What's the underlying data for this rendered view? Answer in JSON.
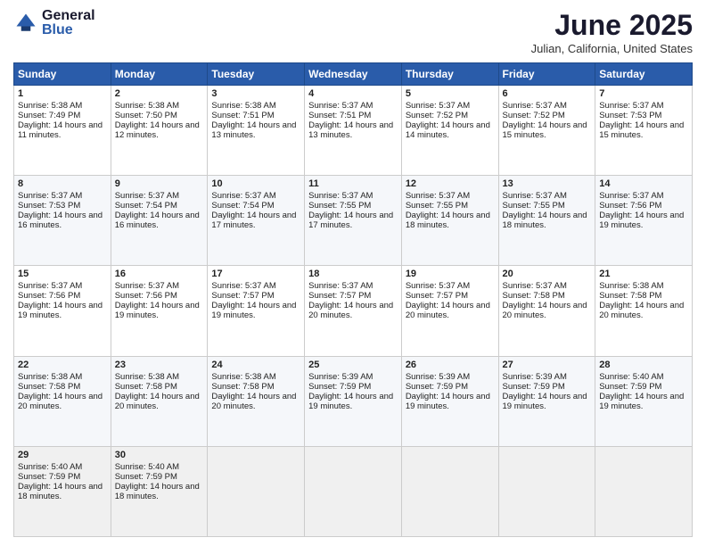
{
  "header": {
    "logo_general": "General",
    "logo_blue": "Blue",
    "month_title": "June 2025",
    "location": "Julian, California, United States"
  },
  "weekdays": [
    "Sunday",
    "Monday",
    "Tuesday",
    "Wednesday",
    "Thursday",
    "Friday",
    "Saturday"
  ],
  "weeks": [
    [
      {
        "day": "1",
        "sunrise": "5:38 AM",
        "sunset": "7:49 PM",
        "daylight": "14 hours and 11 minutes."
      },
      {
        "day": "2",
        "sunrise": "5:38 AM",
        "sunset": "7:50 PM",
        "daylight": "14 hours and 12 minutes."
      },
      {
        "day": "3",
        "sunrise": "5:38 AM",
        "sunset": "7:51 PM",
        "daylight": "14 hours and 13 minutes."
      },
      {
        "day": "4",
        "sunrise": "5:37 AM",
        "sunset": "7:51 PM",
        "daylight": "14 hours and 13 minutes."
      },
      {
        "day": "5",
        "sunrise": "5:37 AM",
        "sunset": "7:52 PM",
        "daylight": "14 hours and 14 minutes."
      },
      {
        "day": "6",
        "sunrise": "5:37 AM",
        "sunset": "7:52 PM",
        "daylight": "14 hours and 15 minutes."
      },
      {
        "day": "7",
        "sunrise": "5:37 AM",
        "sunset": "7:53 PM",
        "daylight": "14 hours and 15 minutes."
      }
    ],
    [
      {
        "day": "8",
        "sunrise": "5:37 AM",
        "sunset": "7:53 PM",
        "daylight": "14 hours and 16 minutes."
      },
      {
        "day": "9",
        "sunrise": "5:37 AM",
        "sunset": "7:54 PM",
        "daylight": "14 hours and 16 minutes."
      },
      {
        "day": "10",
        "sunrise": "5:37 AM",
        "sunset": "7:54 PM",
        "daylight": "14 hours and 17 minutes."
      },
      {
        "day": "11",
        "sunrise": "5:37 AM",
        "sunset": "7:55 PM",
        "daylight": "14 hours and 17 minutes."
      },
      {
        "day": "12",
        "sunrise": "5:37 AM",
        "sunset": "7:55 PM",
        "daylight": "14 hours and 18 minutes."
      },
      {
        "day": "13",
        "sunrise": "5:37 AM",
        "sunset": "7:55 PM",
        "daylight": "14 hours and 18 minutes."
      },
      {
        "day": "14",
        "sunrise": "5:37 AM",
        "sunset": "7:56 PM",
        "daylight": "14 hours and 19 minutes."
      }
    ],
    [
      {
        "day": "15",
        "sunrise": "5:37 AM",
        "sunset": "7:56 PM",
        "daylight": "14 hours and 19 minutes."
      },
      {
        "day": "16",
        "sunrise": "5:37 AM",
        "sunset": "7:56 PM",
        "daylight": "14 hours and 19 minutes."
      },
      {
        "day": "17",
        "sunrise": "5:37 AM",
        "sunset": "7:57 PM",
        "daylight": "14 hours and 19 minutes."
      },
      {
        "day": "18",
        "sunrise": "5:37 AM",
        "sunset": "7:57 PM",
        "daylight": "14 hours and 20 minutes."
      },
      {
        "day": "19",
        "sunrise": "5:37 AM",
        "sunset": "7:57 PM",
        "daylight": "14 hours and 20 minutes."
      },
      {
        "day": "20",
        "sunrise": "5:37 AM",
        "sunset": "7:58 PM",
        "daylight": "14 hours and 20 minutes."
      },
      {
        "day": "21",
        "sunrise": "5:38 AM",
        "sunset": "7:58 PM",
        "daylight": "14 hours and 20 minutes."
      }
    ],
    [
      {
        "day": "22",
        "sunrise": "5:38 AM",
        "sunset": "7:58 PM",
        "daylight": "14 hours and 20 minutes."
      },
      {
        "day": "23",
        "sunrise": "5:38 AM",
        "sunset": "7:58 PM",
        "daylight": "14 hours and 20 minutes."
      },
      {
        "day": "24",
        "sunrise": "5:38 AM",
        "sunset": "7:58 PM",
        "daylight": "14 hours and 20 minutes."
      },
      {
        "day": "25",
        "sunrise": "5:39 AM",
        "sunset": "7:59 PM",
        "daylight": "14 hours and 19 minutes."
      },
      {
        "day": "26",
        "sunrise": "5:39 AM",
        "sunset": "7:59 PM",
        "daylight": "14 hours and 19 minutes."
      },
      {
        "day": "27",
        "sunrise": "5:39 AM",
        "sunset": "7:59 PM",
        "daylight": "14 hours and 19 minutes."
      },
      {
        "day": "28",
        "sunrise": "5:40 AM",
        "sunset": "7:59 PM",
        "daylight": "14 hours and 19 minutes."
      }
    ],
    [
      {
        "day": "29",
        "sunrise": "5:40 AM",
        "sunset": "7:59 PM",
        "daylight": "14 hours and 18 minutes."
      },
      {
        "day": "30",
        "sunrise": "5:40 AM",
        "sunset": "7:59 PM",
        "daylight": "14 hours and 18 minutes."
      },
      null,
      null,
      null,
      null,
      null
    ]
  ]
}
